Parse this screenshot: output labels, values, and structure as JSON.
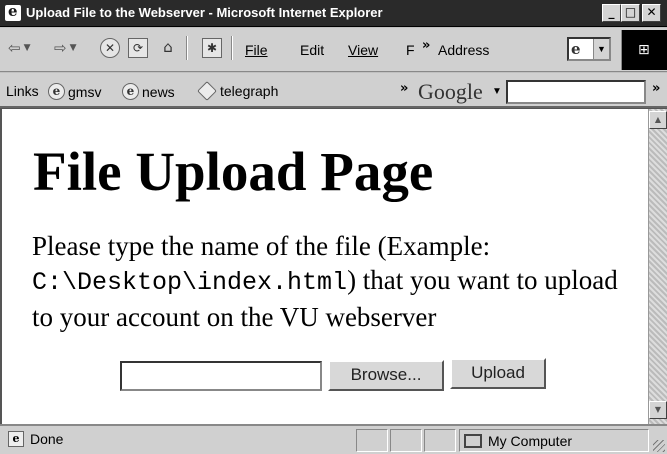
{
  "window": {
    "title": "Upload File to the Webserver - Microsoft Internet Explorer"
  },
  "toolbar": {
    "back_glyph": "⇦",
    "forward_glyph": "⇨",
    "menu": {
      "file": "File",
      "edit": "Edit",
      "view": "View",
      "fav": "F"
    },
    "more_chevron": "»",
    "address_label": "Address"
  },
  "links": {
    "label": "Links",
    "items": [
      "gmsv",
      "news",
      "telegraph"
    ],
    "chevron": "»",
    "google": "Google"
  },
  "page": {
    "heading": "File Upload Page",
    "description_pre": "Please type the name of the file (Example: ",
    "description_code": "C:\\Desktop\\index.html",
    "description_post": ") that you want to upload to your account on the VU webserver",
    "file_input_value": "",
    "browse_label": "Browse...",
    "upload_label": "Upload"
  },
  "status": {
    "text": "Done",
    "zone": "My Computer"
  }
}
